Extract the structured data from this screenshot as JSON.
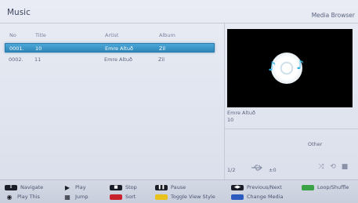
{
  "header": {
    "title": "Music",
    "mode": "Media Browser"
  },
  "columns": {
    "no": "No",
    "title": "Title",
    "artist": "Artist",
    "album": "Album"
  },
  "rows": [
    {
      "no": "0001.",
      "title": "10",
      "artist": "Emre Altuð",
      "album": "Zil",
      "selected": true
    },
    {
      "no": "0002.",
      "title": "11",
      "artist": "Emre Altuð",
      "album": "Zil",
      "selected": false
    }
  ],
  "info": {
    "artist": "Emre Altuð",
    "title": "10",
    "other_label": "Other",
    "page": "1/2",
    "volume": "±0"
  },
  "footer": {
    "navigate": "Navigate",
    "play_this": "Play This",
    "play": "Play",
    "jump": "Jump",
    "stop": "Stop",
    "sort": "Sort",
    "pause": "Pause",
    "toggle_view": "Toggle View Style",
    "prev_next": "Previous/Next",
    "change_media": "Change Media",
    "loop_shuffle": "Loop/Shuffle"
  },
  "colors": {
    "selection": "#3a97c9",
    "red": "#c8232c",
    "yellow": "#e8c21d",
    "blue": "#2c5bc0",
    "green": "#3aa348"
  },
  "icons": [
    "music-note-icon",
    "usb-icon",
    "shuffle-icon",
    "loop-icon",
    "stop-square-icon",
    "play-icon",
    "pause-icon"
  ]
}
